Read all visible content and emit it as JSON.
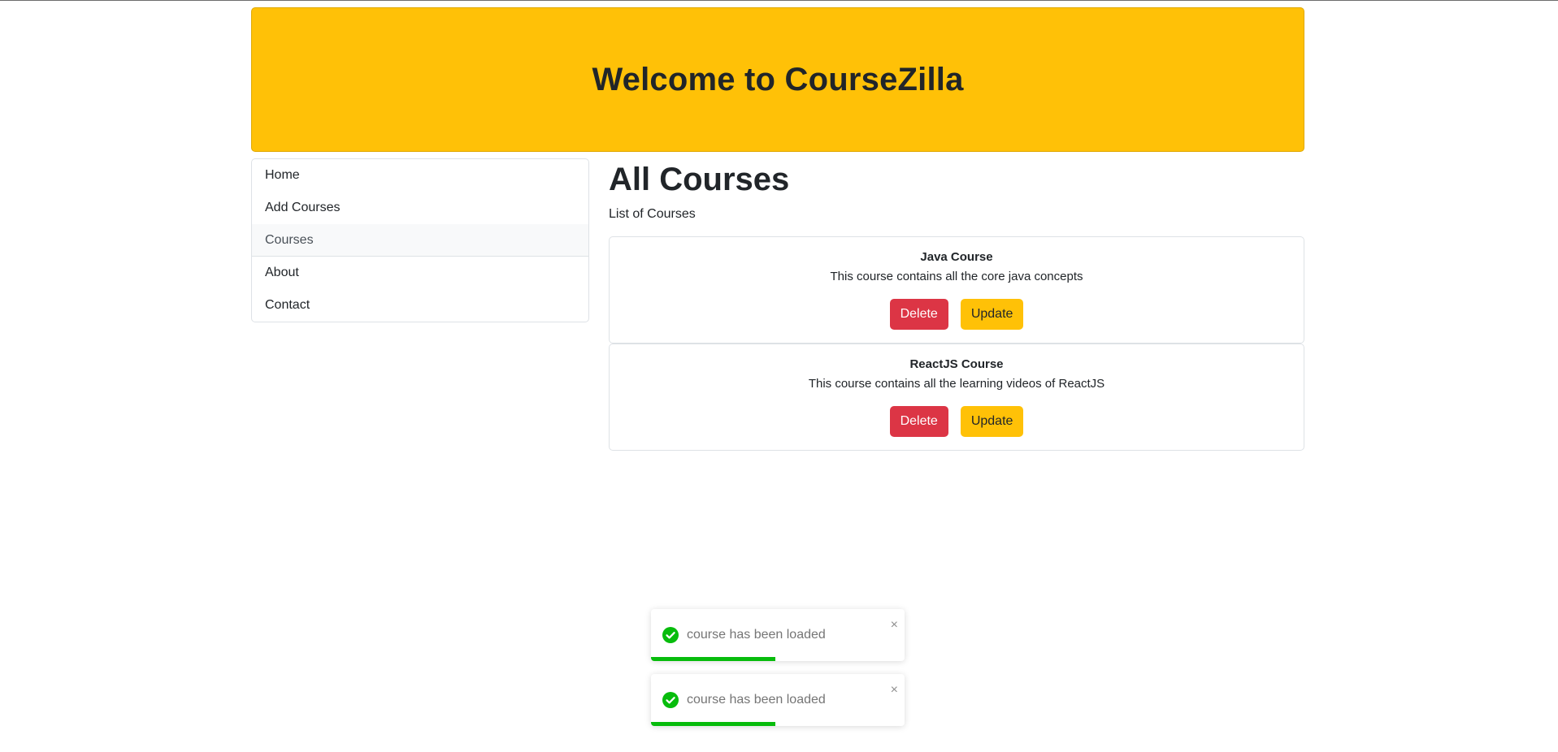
{
  "header": {
    "title": "Welcome to CourseZilla"
  },
  "sidebar": {
    "items": [
      {
        "label": "Home"
      },
      {
        "label": "Add Courses"
      },
      {
        "label": "Courses"
      },
      {
        "label": "About"
      },
      {
        "label": "Contact"
      }
    ]
  },
  "main": {
    "title": "All Courses",
    "subtitle": "List of Courses",
    "courses": [
      {
        "title": "Java Course",
        "description": "This course contains all the core java concepts",
        "delete_label": "Delete",
        "update_label": "Update"
      },
      {
        "title": "ReactJS Course",
        "description": "This course contains all the learning videos of ReactJS",
        "delete_label": "Delete",
        "update_label": "Update"
      }
    ]
  },
  "toasts": [
    {
      "message": "course has been loaded",
      "close_symbol": "×",
      "progress": 0.49
    },
    {
      "message": "course has been loaded",
      "close_symbol": "×",
      "progress": 0.49
    }
  ],
  "colors": {
    "warning": "#ffc107",
    "danger": "#dc3545",
    "success": "#07bc0c"
  },
  "icons": {
    "toast_status": "check-circle-icon",
    "toast_close": "close-icon"
  }
}
